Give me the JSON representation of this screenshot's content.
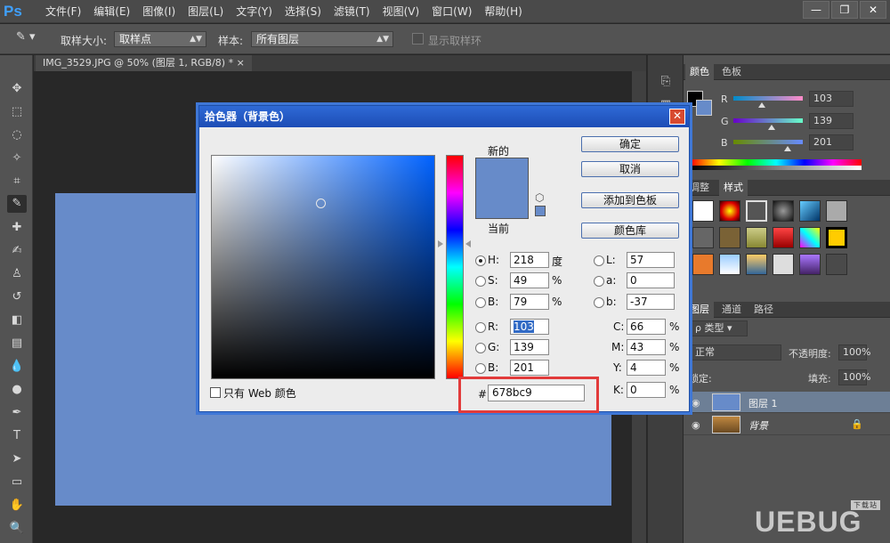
{
  "app": {
    "logo": "Ps"
  },
  "menu": [
    "文件(F)",
    "编辑(E)",
    "图像(I)",
    "图层(L)",
    "文字(Y)",
    "选择(S)",
    "滤镜(T)",
    "视图(V)",
    "窗口(W)",
    "帮助(H)"
  ],
  "window_buttons": [
    "—",
    "❐",
    "✕"
  ],
  "options": {
    "sample_size_label": "取样大小:",
    "sample_size_value": "取样点",
    "sample_label": "样本:",
    "sample_value": "所有图层",
    "show_ring_label": "显示取样环"
  },
  "document": {
    "tab_title": "IMG_3529.JPG @ 50% (图层 1, RGB/8) * ×",
    "canvas_color": "#678bc9"
  },
  "color_panel": {
    "tabs": [
      "颜色",
      "色板"
    ],
    "r_label": "R",
    "r_value": "103",
    "g_label": "G",
    "g_value": "139",
    "b_label": "B",
    "b_value": "201",
    "r_level": 0.404,
    "g_level": 0.545,
    "b_level": 0.788
  },
  "styles_panel": {
    "tabs": [
      "调整",
      "样式"
    ]
  },
  "layers_panel": {
    "tabs": [
      "图层",
      "通道",
      "路径"
    ],
    "filter_kind": "类型",
    "blend_mode": "正常",
    "opacity_label": "不透明度:",
    "opacity_value": "100%",
    "lock_label": "锁定:",
    "fill_label": "填充:",
    "fill_value": "100%",
    "layers": [
      {
        "name": "图层 1",
        "selected": true
      },
      {
        "name": "背景",
        "selected": false
      }
    ]
  },
  "dialog": {
    "title": "拾色器（背景色）",
    "close": "✕",
    "new_label": "新的",
    "current_label": "当前",
    "new_color": "#678bc9",
    "current_color": "#678bc9",
    "buttons": {
      "ok": "确定",
      "cancel": "取消",
      "add_swatch": "添加到色板",
      "libraries": "颜色库"
    },
    "web_only_label": "只有 Web 颜色",
    "hsb": {
      "h_label": "H:",
      "h": "218",
      "h_unit": "度",
      "s_label": "S:",
      "s": "49",
      "s_unit": "%",
      "b_label": "B:",
      "b": "79",
      "b_unit": "%"
    },
    "rgb": {
      "r_label": "R:",
      "r": "103",
      "g_label": "G:",
      "g": "139",
      "b_label": "B:",
      "b": "201"
    },
    "lab": {
      "l_label": "L:",
      "l": "57",
      "a_label": "a:",
      "a": "0",
      "b_label": "b:",
      "b": "-37"
    },
    "cmyk": {
      "c_label": "C:",
      "c": "66",
      "m_label": "M:",
      "m": "43",
      "y_label": "Y:",
      "y": "4",
      "k_label": "K:",
      "k": "0",
      "unit": "%"
    },
    "hex_label": "#",
    "hex": "678bc9"
  },
  "watermark": {
    "text": "UEBUG",
    "badge": "下载站"
  }
}
